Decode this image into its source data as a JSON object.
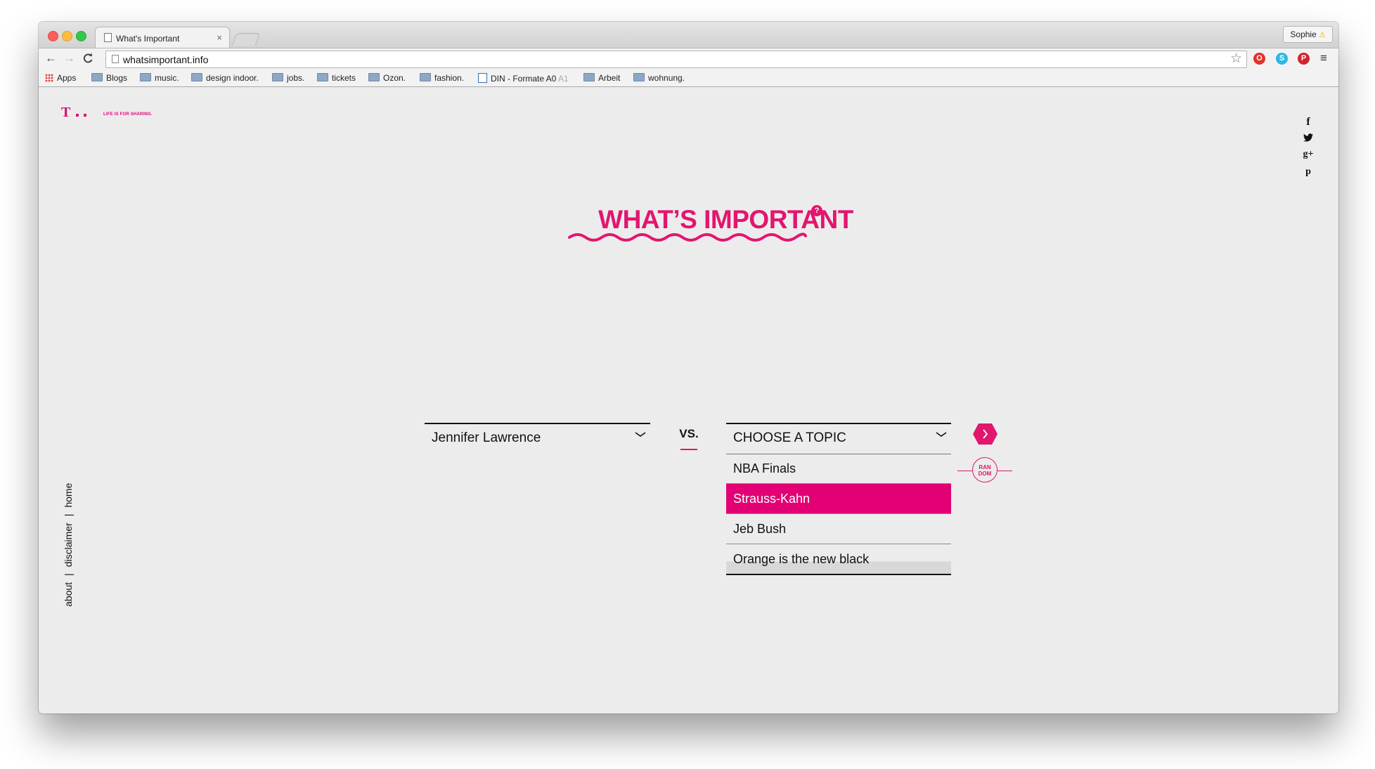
{
  "browser": {
    "tab_title": "What's Important",
    "tab_close": "×",
    "profile_name": "Sophie",
    "profile_warning": "⚠",
    "url": "whatsimportant.info",
    "star": "☆",
    "menu": "≡",
    "nav": {
      "back": "←",
      "forward": "→",
      "reload": "C"
    },
    "bookmarks": [
      {
        "label": "Apps",
        "icon": "apps-grid-icon"
      },
      {
        "label": "Blogs",
        "icon": "folder-icon"
      },
      {
        "label": "music.",
        "icon": "folder-icon"
      },
      {
        "label": "design indoor.",
        "icon": "folder-icon"
      },
      {
        "label": "jobs.",
        "icon": "folder-icon"
      },
      {
        "label": "tickets",
        "icon": "folder-icon"
      },
      {
        "label": "Ozon.",
        "icon": "folder-icon"
      },
      {
        "label": "fashion.",
        "icon": "folder-icon"
      },
      {
        "label": "DIN - Formate A0",
        "suffix": "A1",
        "icon": "document-icon"
      },
      {
        "label": "Arbeit",
        "icon": "folder-icon"
      },
      {
        "label": "wohnung.",
        "icon": "folder-icon"
      }
    ],
    "extensions": {
      "opera": "O",
      "share": "S",
      "pinterest": "P"
    }
  },
  "page": {
    "logo_tagline": "LIFE IS FOR SHARING.",
    "logo_letter": "T",
    "headline": "WHAT’S IMPORTANT",
    "help_badge": "?",
    "left_select_value": "Jennifer Lawrence",
    "vs_label": "VS.",
    "right_select_placeholder": "CHOOSE A TOPIC",
    "topic_options": [
      {
        "label": "NBA Finals",
        "selected": false
      },
      {
        "label": "Strauss-Kahn",
        "selected": true
      },
      {
        "label": "Jeb Bush",
        "selected": false
      },
      {
        "label": "Orange is the new black",
        "selected": false
      }
    ],
    "random_label_1": "RAN",
    "random_label_2": "DOM",
    "social": {
      "facebook": "f",
      "twitter": "🐦",
      "googleplus": "g+",
      "pinterest": "p"
    },
    "sidenav": {
      "about": "about",
      "disclaimer": "disclaimer",
      "home": "home",
      "separator": "|"
    }
  },
  "colors": {
    "accent": "#e2156f",
    "brand": "#e20074",
    "background": "#ececec"
  }
}
